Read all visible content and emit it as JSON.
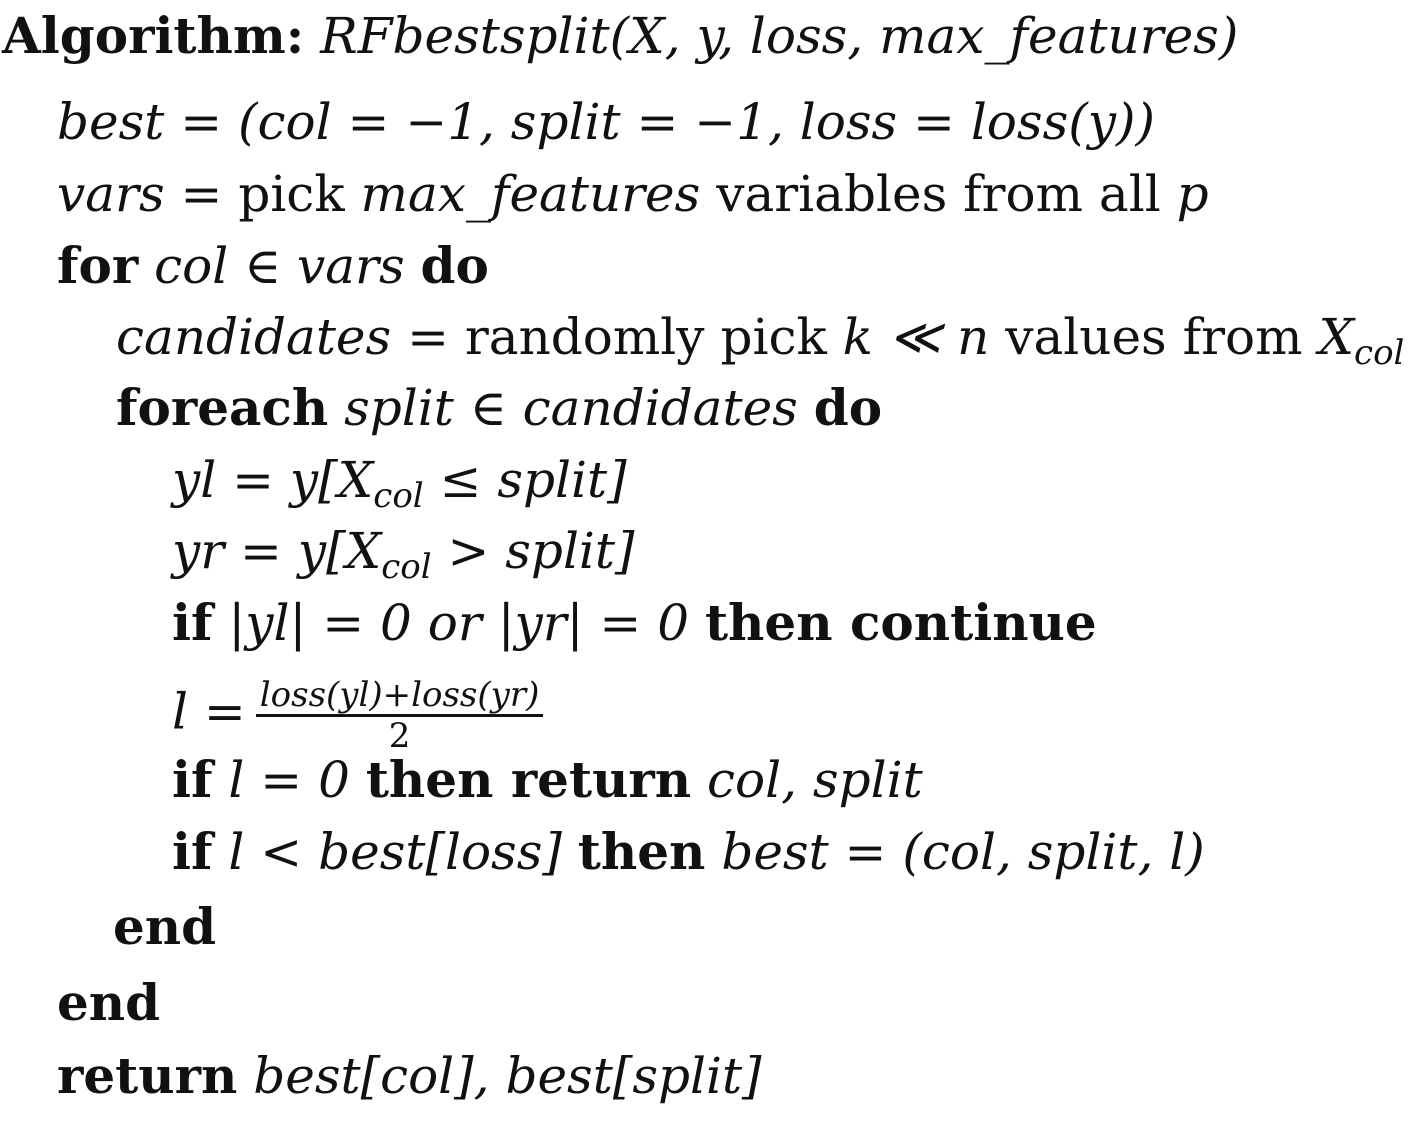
{
  "algorithm": {
    "heading_label": "Algorithm:",
    "signature": "RFbestsplit(X, y, loss, max_features)"
  },
  "lines": {
    "l1": {
      "text": "best = (col = −1, split = −1, loss = loss(y))"
    },
    "l2": {
      "lhs": "vars =",
      "t1": "pick",
      "max_features": "max_features",
      "t2": "variables from all",
      "p": "p"
    },
    "l3": {
      "for_kw": "for",
      "cond": "col ∈ vars",
      "do_kw": "do"
    },
    "l4": {
      "lhs": "candidates =",
      "t1": "randomly pick",
      "k_n": "k ≪ n",
      "t2": "values from",
      "X": "X",
      "col": "col"
    },
    "l5": {
      "foreach_kw": "foreach",
      "cond": "split ∈ candidates",
      "do_kw": "do"
    },
    "l6": {
      "a": "yl = y[X",
      "col": "col",
      "b": "≤ split]"
    },
    "l7": {
      "a": "yr = y[X",
      "col": "col",
      "b": "> split]"
    },
    "l8": {
      "if_kw": "if",
      "c1": "|yl| = 0",
      "or_kw": "or",
      "c2": "|yr| = 0",
      "then_kw": "then continue"
    },
    "l9": {
      "lhs": "l =",
      "numerator": "loss(yl)+loss(yr)",
      "denominator": "2"
    },
    "l10": {
      "if_kw": "if",
      "cond": "l = 0",
      "then_kw": "then return",
      "ret": "col, split"
    },
    "l11": {
      "if_kw": "if",
      "cond": "l < best[loss]",
      "then_kw": "then",
      "assign": "best = (col, split, l)"
    },
    "l12": {
      "end_kw": "end"
    },
    "l13": {
      "end_kw": "end"
    },
    "l14": {
      "return_kw": "return",
      "ret": "best[col], best[split]"
    }
  }
}
